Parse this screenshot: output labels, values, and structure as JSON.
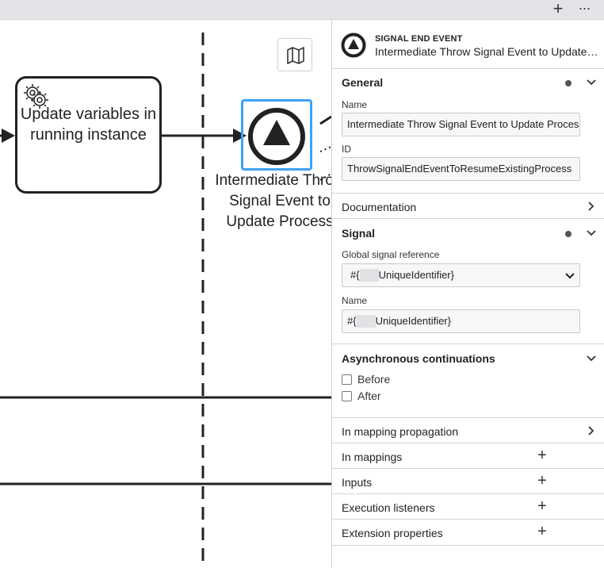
{
  "topbar": {
    "add_icon": "plus-icon",
    "more_icon": "more-icon"
  },
  "canvas": {
    "task_label": "Update variables in running instance",
    "event_label": "Intermediate Throw Signal Event to Update Process"
  },
  "header": {
    "type": "SIGNAL END EVENT",
    "title": "Intermediate Throw Signal Event to Update Process"
  },
  "general": {
    "title": "General",
    "name_label": "Name",
    "name_value": "Intermediate Throw Signal Event to Update Process",
    "id_label": "ID",
    "id_value": "ThrowSignalEndEventToResumeExistingProcess"
  },
  "documentation": {
    "title": "Documentation"
  },
  "signal": {
    "title": "Signal",
    "ref_label": "Global signal reference",
    "ref_prefix": "#{",
    "ref_suffix": "UniqueIdentifier}",
    "name_label": "Name",
    "name_prefix": "#{",
    "name_suffix": "UniqueIdentifier}"
  },
  "async": {
    "title": "Asynchronous continuations",
    "before": "Before",
    "after": "After"
  },
  "in_mapping_propagation": {
    "title": "In mapping propagation"
  },
  "in_mappings": {
    "title": "In mappings"
  },
  "inputs": {
    "title": "Inputs"
  },
  "execution_listeners": {
    "title": "Execution listeners"
  },
  "extension_properties": {
    "title": "Extension properties"
  },
  "colors": {
    "selection": "#3fa2f5",
    "stroke": "#222222"
  }
}
